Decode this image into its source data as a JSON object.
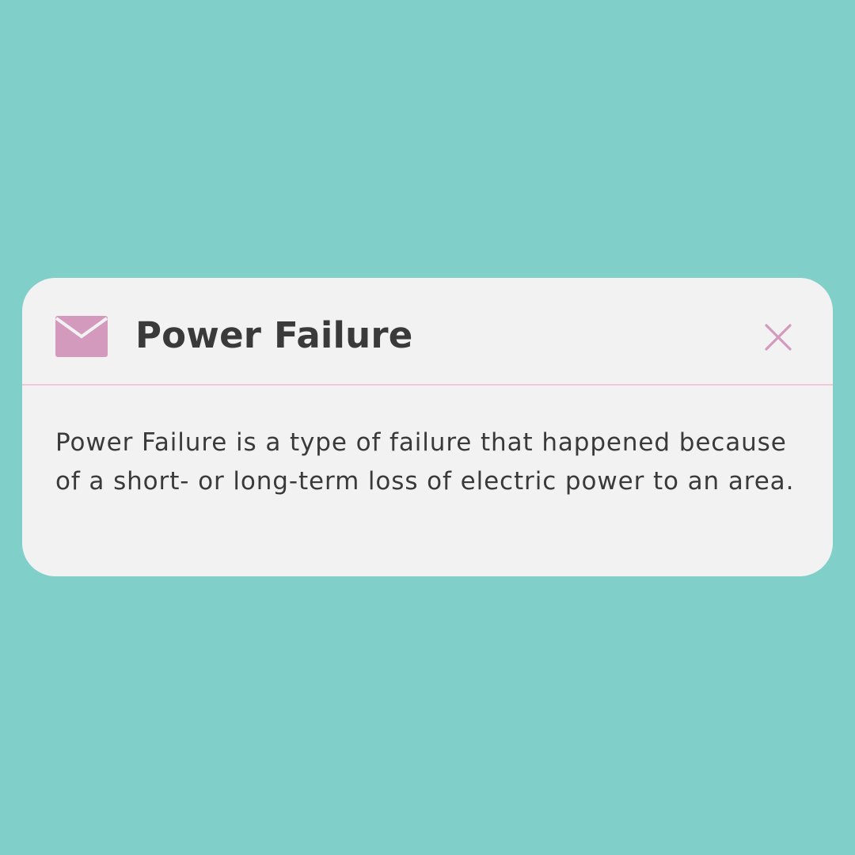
{
  "theme": {
    "background": "#80CFC8",
    "card_background": "#F2F2F2",
    "accent": "#D39ABD",
    "divider": "#F0C6DD",
    "text": "#3A3A3A"
  },
  "notification": {
    "icon": "mail-icon",
    "title": "Power Failure",
    "close_icon": "close-icon",
    "message": "Power Failure is a type of failure that happened because of a short- or long-term loss of electric power to an area."
  }
}
